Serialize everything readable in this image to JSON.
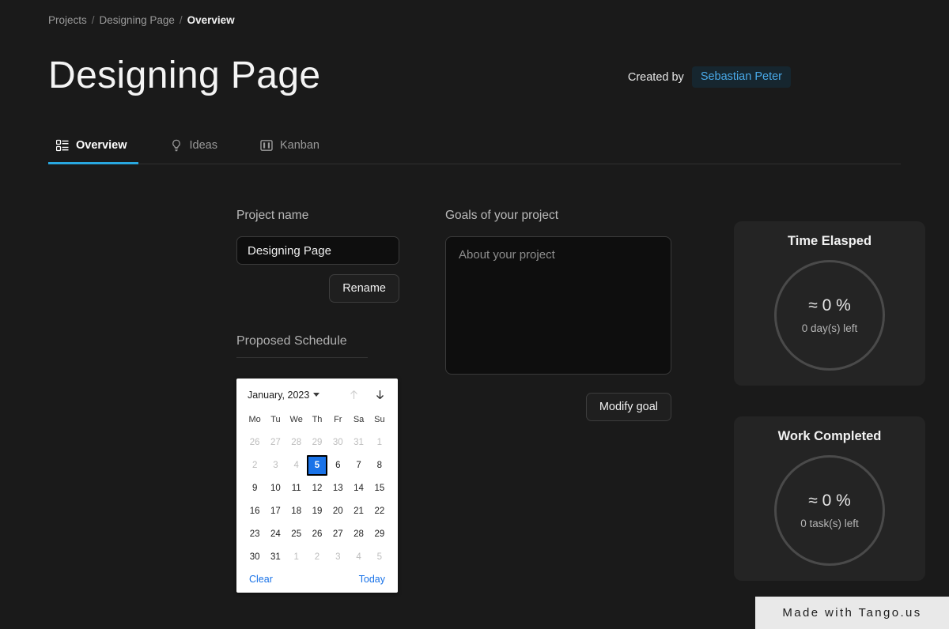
{
  "breadcrumb": {
    "items": [
      "Projects",
      "Designing Page",
      "Overview"
    ],
    "separator": "/"
  },
  "header": {
    "title": "Designing Page",
    "created_by_label": "Created by",
    "author": "Sebastian Peter",
    "author_badge_color": "#49a9e8",
    "author_badge_bg": "#16262f"
  },
  "tabs": {
    "accent_color": "#29a8e0",
    "items": [
      {
        "label": "Overview",
        "icon": "dashboard-list-icon",
        "active": true
      },
      {
        "label": "Ideas",
        "icon": "lightbulb-icon",
        "active": false
      },
      {
        "label": "Kanban",
        "icon": "board-icon",
        "active": false
      }
    ]
  },
  "project_name": {
    "label": "Project name",
    "value": "Designing Page",
    "placeholder": "Project name",
    "rename_label": "Rename"
  },
  "schedule": {
    "heading": "Proposed Schedule",
    "calendar": {
      "month_label": "January, 2023",
      "prev_label": "Previous month",
      "next_label": "Next month",
      "weekdays": [
        "Mo",
        "Tu",
        "We",
        "Th",
        "Fr",
        "Sa",
        "Su"
      ],
      "selected_day": 5,
      "selected_color": "#1a73e8",
      "weeks": [
        [
          {
            "d": "26",
            "m": true
          },
          {
            "d": "27",
            "m": true
          },
          {
            "d": "28",
            "m": true
          },
          {
            "d": "29",
            "m": true
          },
          {
            "d": "30",
            "m": true
          },
          {
            "d": "31",
            "m": true
          },
          {
            "d": "1",
            "m": true
          }
        ],
        [
          {
            "d": "2",
            "m": true
          },
          {
            "d": "3",
            "m": true
          },
          {
            "d": "4",
            "m": true
          },
          {
            "d": "5",
            "m": false,
            "s": true
          },
          {
            "d": "6",
            "m": false
          },
          {
            "d": "7",
            "m": false
          },
          {
            "d": "8",
            "m": false
          }
        ],
        [
          {
            "d": "9",
            "m": false
          },
          {
            "d": "10",
            "m": false
          },
          {
            "d": "11",
            "m": false
          },
          {
            "d": "12",
            "m": false
          },
          {
            "d": "13",
            "m": false
          },
          {
            "d": "14",
            "m": false
          },
          {
            "d": "15",
            "m": false
          }
        ],
        [
          {
            "d": "16",
            "m": false
          },
          {
            "d": "17",
            "m": false
          },
          {
            "d": "18",
            "m": false
          },
          {
            "d": "19",
            "m": false
          },
          {
            "d": "20",
            "m": false
          },
          {
            "d": "21",
            "m": false
          },
          {
            "d": "22",
            "m": false
          }
        ],
        [
          {
            "d": "23",
            "m": false
          },
          {
            "d": "24",
            "m": false
          },
          {
            "d": "25",
            "m": false
          },
          {
            "d": "26",
            "m": false
          },
          {
            "d": "27",
            "m": false
          },
          {
            "d": "28",
            "m": false
          },
          {
            "d": "29",
            "m": false
          }
        ],
        [
          {
            "d": "30",
            "m": false
          },
          {
            "d": "31",
            "m": false
          },
          {
            "d": "1",
            "m": true
          },
          {
            "d": "2",
            "m": true
          },
          {
            "d": "3",
            "m": true
          },
          {
            "d": "4",
            "m": true
          },
          {
            "d": "5",
            "m": true
          }
        ]
      ],
      "clear_label": "Clear",
      "today_label": "Today"
    }
  },
  "goals": {
    "label": "Goals of your project",
    "value": "",
    "placeholder": "About your project",
    "modify_label": "Modify goal"
  },
  "stats": [
    {
      "title": "Time Elasped",
      "percent": "≈ 0 %",
      "subtitle": "0 day(s) left"
    },
    {
      "title": "Work Completed",
      "percent": "≈ 0 %",
      "subtitle": "0 task(s) left"
    }
  ],
  "watermark": {
    "text": "Made with Tango.us"
  }
}
